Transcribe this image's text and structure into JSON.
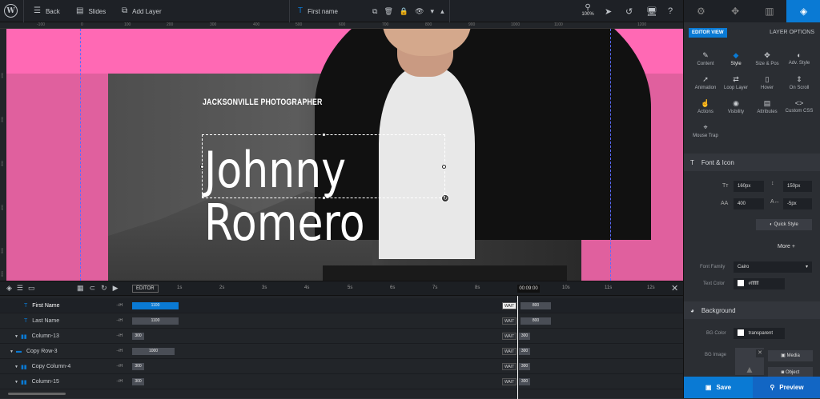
{
  "topbar": {
    "back_label": "Back",
    "slides_label": "Slides",
    "add_layer_label": "Add Layer",
    "layer_name": "First name",
    "zoom_level": "100%"
  },
  "ruler": {
    "h_ticks": [
      "-100",
      "0",
      "100",
      "200",
      "300",
      "400",
      "500",
      "600",
      "700",
      "800",
      "900",
      "1000",
      "1100",
      "1200"
    ],
    "v_ticks": [
      "100",
      "200",
      "300",
      "400",
      "500",
      "600"
    ]
  },
  "canvas": {
    "subtitle": "JACKSONVILLE PHOTOGRAPHER",
    "title_line1": "Johnny",
    "title_line2": "Romero"
  },
  "timeline": {
    "editor_label": "EDITOR",
    "current_time": "00:09:00",
    "ticks": [
      "1s",
      "2s",
      "3s",
      "4s",
      "5s",
      "6s",
      "7s",
      "8s",
      "10s",
      "11s",
      "12s"
    ],
    "end_marker": "⊣H",
    "wait_label": "WAIT",
    "rows": [
      {
        "name": "First Name",
        "icon": "text",
        "start": "1100",
        "end": "800"
      },
      {
        "name": "Last Name",
        "icon": "text",
        "start": "1100",
        "end": "800"
      },
      {
        "name": "Column-13",
        "icon": "column",
        "start": "300",
        "end": "300"
      },
      {
        "name": "Copy Row-3",
        "icon": "row",
        "start": "1000",
        "end": "300"
      },
      {
        "name": "Copy Column-4",
        "icon": "column",
        "start": "300",
        "end": "300"
      },
      {
        "name": "Column-15",
        "icon": "column",
        "start": "300",
        "end": "300"
      }
    ]
  },
  "panel": {
    "editor_view": "EDITOR VIEW",
    "layer_options": "LAYER OPTIONS",
    "grid": [
      {
        "label": "Content",
        "icon": "pencil-icon"
      },
      {
        "label": "Style",
        "icon": "palette-icon"
      },
      {
        "label": "Size & Pos",
        "icon": "move-icon"
      },
      {
        "label": "Adv. Style",
        "icon": "contrast-icon"
      },
      {
        "label": "Animation",
        "icon": "animation-icon"
      },
      {
        "label": "Loop Layer",
        "icon": "loop-icon"
      },
      {
        "label": "Hover",
        "icon": "mouse-icon"
      },
      {
        "label": "On Scroll",
        "icon": "scroll-icon"
      },
      {
        "label": "Actions",
        "icon": "hand-icon"
      },
      {
        "label": "Visbility",
        "icon": "eye-icon"
      },
      {
        "label": "Attributes",
        "icon": "document-icon"
      },
      {
        "label": "Custom CSS",
        "icon": "code-icon"
      },
      {
        "label": "Mouse Trap",
        "icon": "crosshair-icon"
      }
    ],
    "font_section": "Font & Icon",
    "font_size": "160px",
    "line_height": "150px",
    "font_weight": "400",
    "letter_spacing": "-5px",
    "quick_style": "Quick Style",
    "more": "More",
    "font_family_label": "Font Family",
    "font_family_value": "Cairo",
    "text_color_label": "Text Color",
    "text_color_value": "#ffffff",
    "background_section": "Background",
    "bg_color_label": "BG Color",
    "bg_color_value": "transparent",
    "bg_image_label": "BG Image",
    "media_label": "Media",
    "object_label": "Object",
    "save_label": "Save",
    "preview_label": "Preview"
  },
  "colors": {
    "accent": "#0a7ad4",
    "pink": "#ff69b4"
  }
}
